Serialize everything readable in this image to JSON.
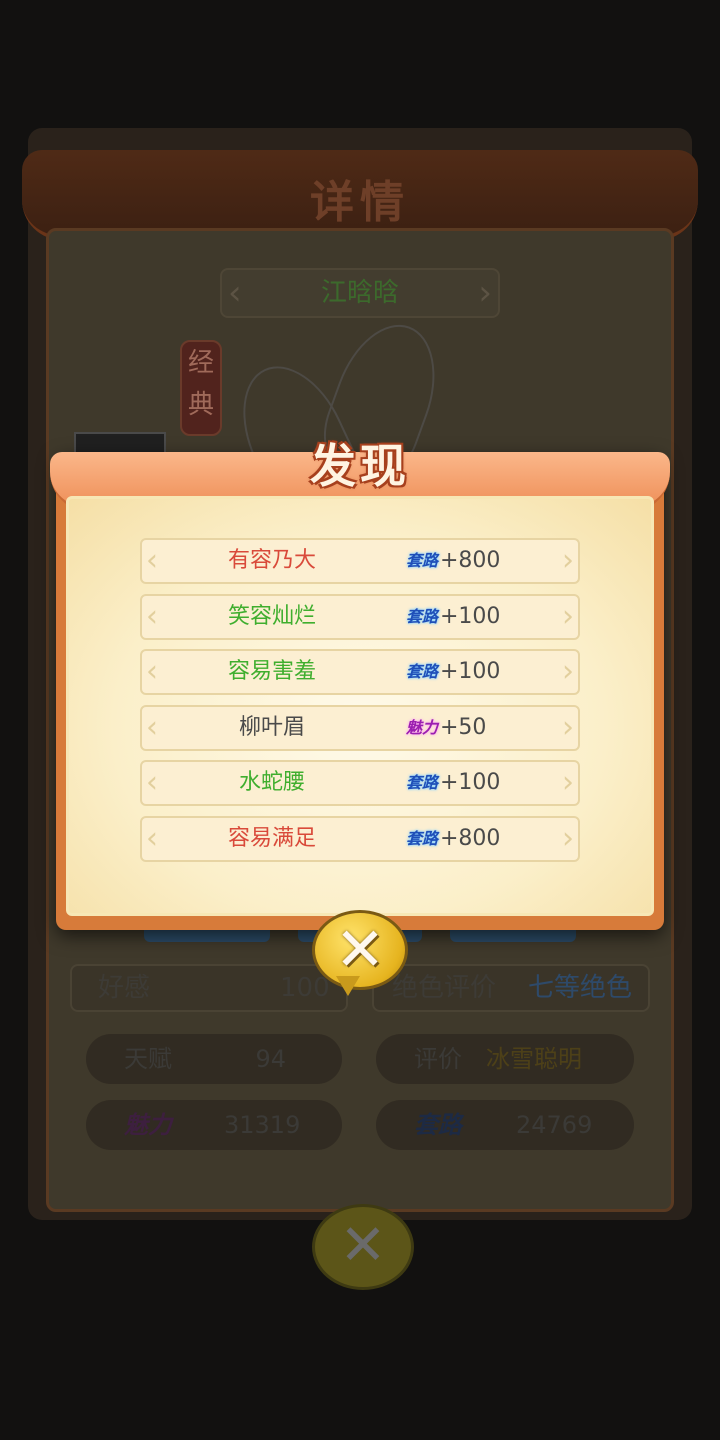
{
  "background": {
    "title": "详情",
    "name": "江晗晗",
    "tag": "经典",
    "favor_label": "好感",
    "favor_value": "100",
    "beauty_label": "绝色评价",
    "beauty_value": "七等绝色",
    "talent_label": "天赋",
    "talent_value": "94",
    "rating_label": "评价",
    "rating_value": "冰雪聪明",
    "charm_label": "魅力",
    "charm_value": "31319",
    "routine_label": "套路",
    "routine_value": "24769",
    "close_icon": "close-icon"
  },
  "modal": {
    "title": "发现",
    "items": [
      {
        "name": "有容乃大",
        "color": "#d94a3a",
        "badge": "套路",
        "badge_type": "taolu",
        "value": "+800"
      },
      {
        "name": "笑容灿烂",
        "color": "#3fae2e",
        "badge": "套路",
        "badge_type": "taolu",
        "value": "+100"
      },
      {
        "name": "容易害羞",
        "color": "#3fae2e",
        "badge": "套路",
        "badge_type": "taolu",
        "value": "+100"
      },
      {
        "name": "柳叶眉",
        "color": "#4a4a4a",
        "badge": "魅力",
        "badge_type": "meili",
        "value": "+50"
      },
      {
        "name": "水蛇腰",
        "color": "#3fae2e",
        "badge": "套路",
        "badge_type": "taolu",
        "value": "+100"
      },
      {
        "name": "容易满足",
        "color": "#d94a3a",
        "badge": "套路",
        "badge_type": "taolu",
        "value": "+800"
      }
    ],
    "close_symbol": "✕"
  }
}
